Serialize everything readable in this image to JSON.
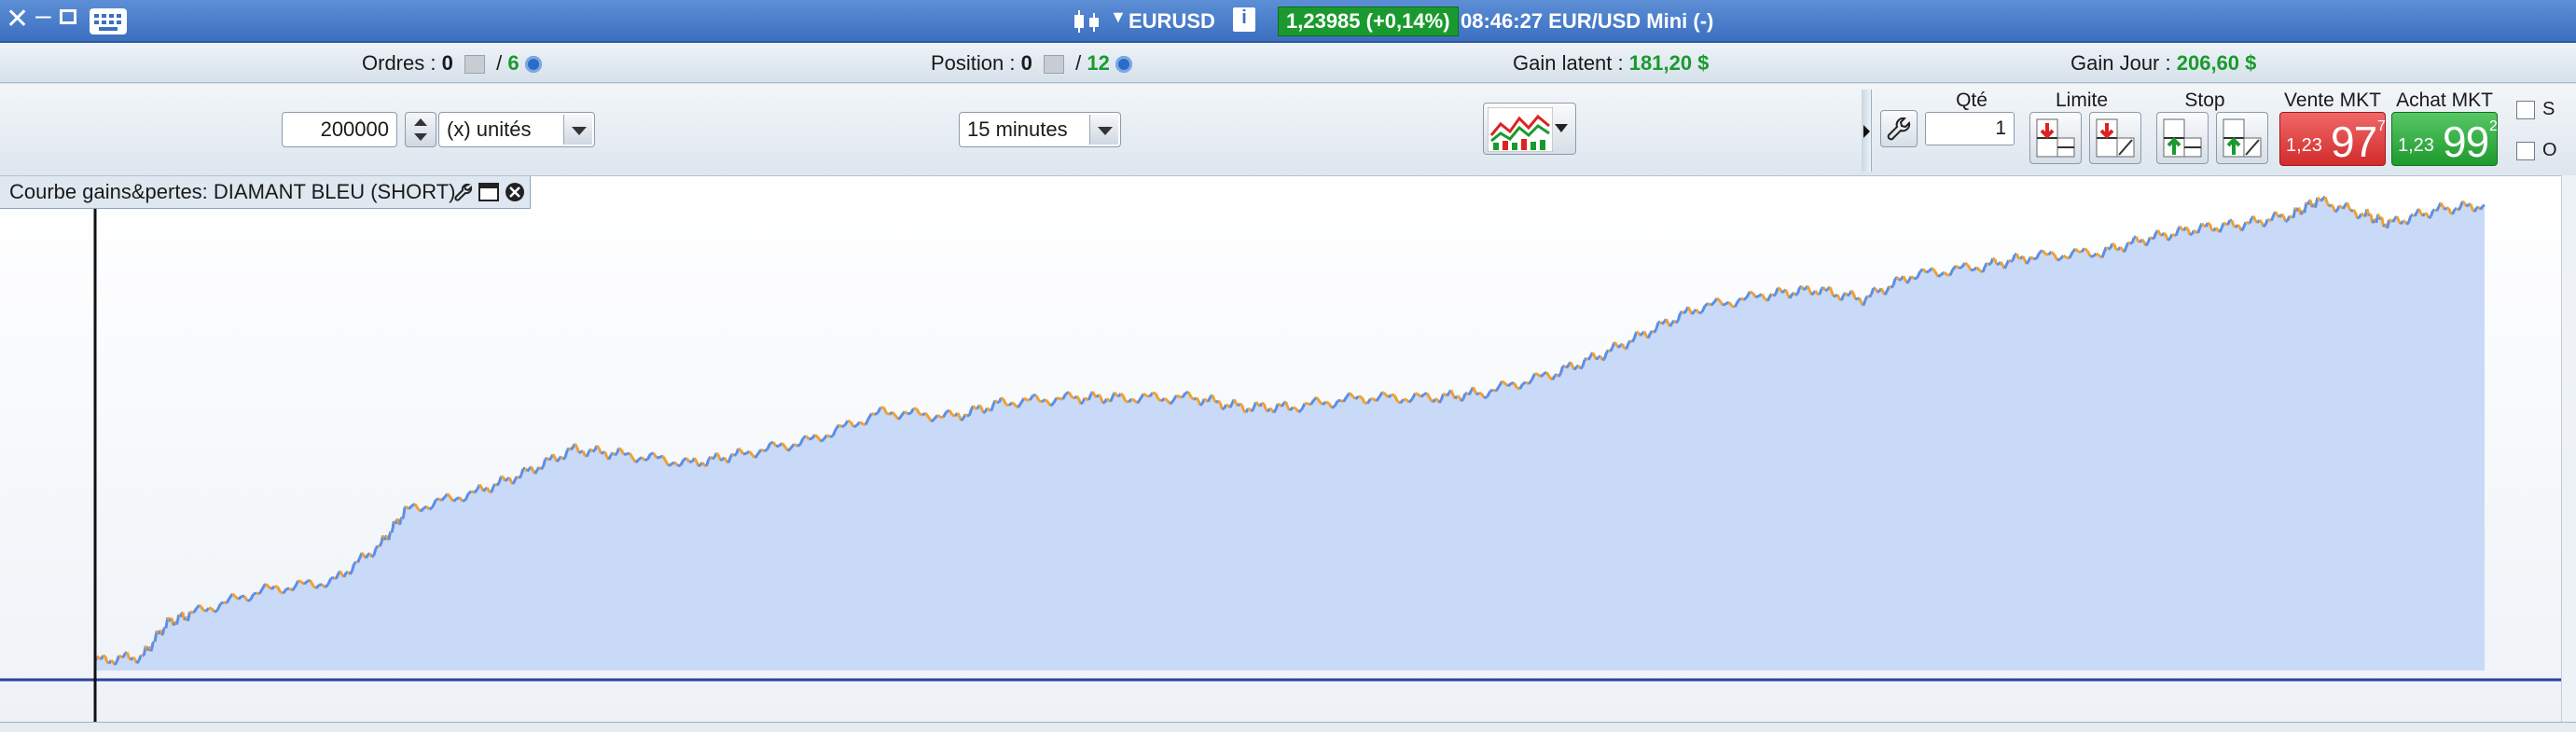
{
  "window": {
    "symbol": "EURUSD",
    "price_badge": "1,23985 (+0,14%)",
    "time_label": "08:46:27 EUR/USD Mini (-)",
    "info_icon_text": "i"
  },
  "info_strip": {
    "orders_label": "Ordres :",
    "orders_count": "0",
    "orders_separator": "/",
    "orders_total": "6",
    "position_label": "Position :",
    "position_count": "0",
    "position_separator": "/",
    "position_total": "12",
    "latent_label": "Gain latent :",
    "latent_value": "181,20 $",
    "day_label": "Gain Jour :",
    "day_value": "206,60 $"
  },
  "toolbar": {
    "quantity": "200000",
    "unit": "(x) unités",
    "timeframe": "15 minutes"
  },
  "trade_panel": {
    "qte_label": "Qté",
    "qte_value": "1",
    "limit_label": "Limite",
    "stop_label": "Stop",
    "sell_label": "Vente MKT",
    "sell_small": "1,23",
    "sell_big": "97",
    "sell_sup": "7",
    "buy_label": "Achat MKT",
    "buy_small": "1,23",
    "buy_big": "99",
    "buy_sup": "2",
    "check_s": "S",
    "check_o": "O"
  },
  "chart": {
    "title": "Courbe gains&pertes: DIAMANT BLEU (SHORT)"
  },
  "chart_data": {
    "type": "area",
    "title": "Courbe gains&pertes: DIAMANT BLEU (SHORT)",
    "x_unit": "relative position (0-1)",
    "y_unit": "relative equity (0-1)",
    "grid": false,
    "series": [
      {
        "color_up": "#5b8ee6",
        "color_down": "#f0a030",
        "fill": "#c9daf8",
        "points": [
          [
            0.0,
            0.02
          ],
          [
            0.02,
            0.03
          ],
          [
            0.03,
            0.1
          ],
          [
            0.04,
            0.12
          ],
          [
            0.07,
            0.17
          ],
          [
            0.1,
            0.19
          ],
          [
            0.12,
            0.27
          ],
          [
            0.13,
            0.34
          ],
          [
            0.16,
            0.38
          ],
          [
            0.18,
            0.42
          ],
          [
            0.2,
            0.47
          ],
          [
            0.22,
            0.46
          ],
          [
            0.25,
            0.44
          ],
          [
            0.27,
            0.46
          ],
          [
            0.3,
            0.49
          ],
          [
            0.33,
            0.55
          ],
          [
            0.36,
            0.54
          ],
          [
            0.38,
            0.57
          ],
          [
            0.41,
            0.58
          ],
          [
            0.43,
            0.58
          ],
          [
            0.46,
            0.58
          ],
          [
            0.48,
            0.56
          ],
          [
            0.5,
            0.56
          ],
          [
            0.53,
            0.58
          ],
          [
            0.56,
            0.58
          ],
          [
            0.58,
            0.59
          ],
          [
            0.61,
            0.63
          ],
          [
            0.63,
            0.67
          ],
          [
            0.65,
            0.72
          ],
          [
            0.67,
            0.77
          ],
          [
            0.7,
            0.8
          ],
          [
            0.72,
            0.81
          ],
          [
            0.74,
            0.79
          ],
          [
            0.76,
            0.84
          ],
          [
            0.79,
            0.86
          ],
          [
            0.81,
            0.88
          ],
          [
            0.84,
            0.89
          ],
          [
            0.86,
            0.92
          ],
          [
            0.88,
            0.94
          ],
          [
            0.9,
            0.95
          ],
          [
            0.92,
            0.97
          ],
          [
            0.93,
            1.0
          ],
          [
            0.95,
            0.97
          ],
          [
            0.96,
            0.95
          ],
          [
            0.98,
            0.98
          ],
          [
            1.0,
            0.99
          ]
        ]
      }
    ]
  }
}
